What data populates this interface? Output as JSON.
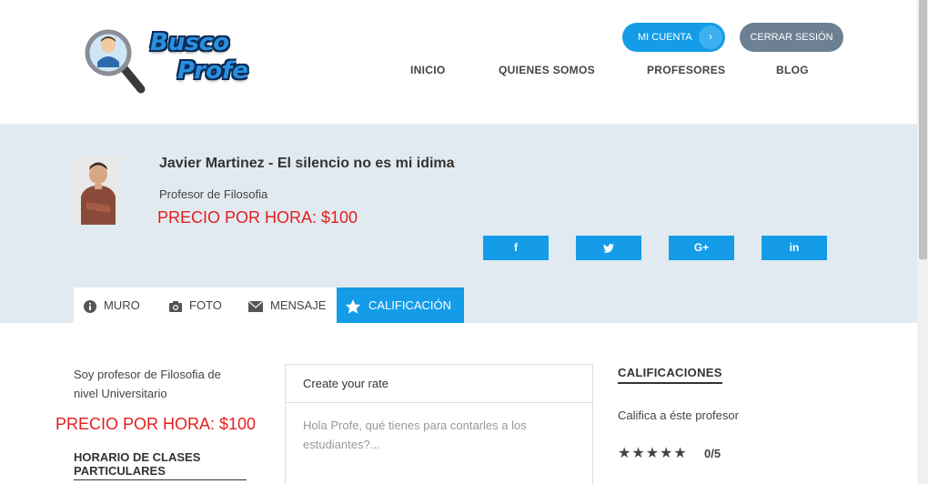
{
  "logo": {
    "line1": "Busco",
    "line2": "Profe"
  },
  "header": {
    "account_button": "MI CUENTA",
    "logout_button": "CERRAR SESIÓN",
    "nav": [
      "INICIO",
      "QUIENES SOMOS",
      "PROFESORES",
      "BLOG"
    ]
  },
  "profile": {
    "name": "Javier Martinez - El silencio no es mi idima",
    "subject": "Profesor de Filosofia",
    "price": "PRECIO POR HORA: $100",
    "social": [
      "f",
      "twitter-icon",
      "G+",
      "in"
    ]
  },
  "tabs": [
    "MURO",
    "FOTO",
    "MENSAJE",
    "CALIFICACIÓN"
  ],
  "content": {
    "intro": "Soy profesor de Filosofia de nivel Universitario",
    "price": "PRECIO POR HORA: $100",
    "horario": "HORARIO DE CLASES PARTICULARES"
  },
  "rate": {
    "title": "Create your rate",
    "placeholder": "Hola Profe, qué tienes para contarles a los estudiantes?..."
  },
  "ratings": {
    "heading": "CALIFICACIONES",
    "subtitle": "Califica a éste profesor",
    "score": "0/5",
    "stars": 0
  },
  "colors": {
    "accent": "#149ce8",
    "price": "#e41e1e",
    "banner": "#e2eaf1",
    "logout": "#6d7f93"
  }
}
